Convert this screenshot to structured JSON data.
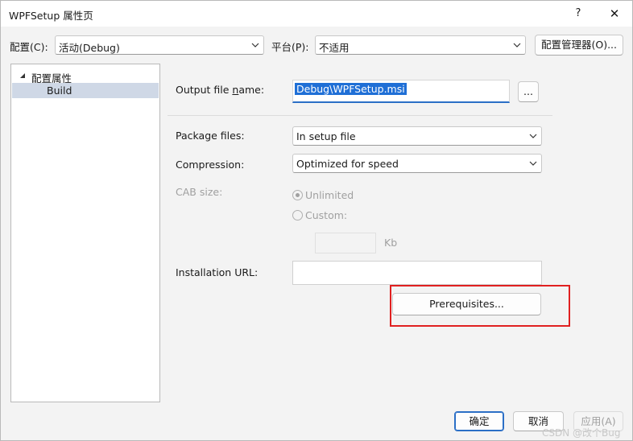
{
  "window": {
    "title": "WPFSetup 属性页",
    "help": "?",
    "close": "✕"
  },
  "toolbar": {
    "config_label": "配置(C):",
    "config_value": "活动(Debug)",
    "platform_label": "平台(P):",
    "platform_value": "不适用",
    "config_manager": "配置管理器(O)..."
  },
  "tree": {
    "root": "配置属性",
    "child": "Build"
  },
  "build": {
    "output_label": "Output file name:",
    "output_value": "Debug\\WPFSetup.msi",
    "browse": "...",
    "package_label": "Package files:",
    "package_value": "In setup file",
    "compression_label": "Compression:",
    "compression_value": "Optimized for speed",
    "cab_label": "CAB size:",
    "unlimited": "Unlimited",
    "custom": "Custom:",
    "kb": "Kb",
    "install_url_label": "Installation URL:",
    "install_url_value": "",
    "prerequisites": "Prerequisites..."
  },
  "footer": {
    "ok": "确定",
    "cancel": "取消",
    "apply": "应用(A)",
    "watermark": "CSDN @改个Bug"
  }
}
